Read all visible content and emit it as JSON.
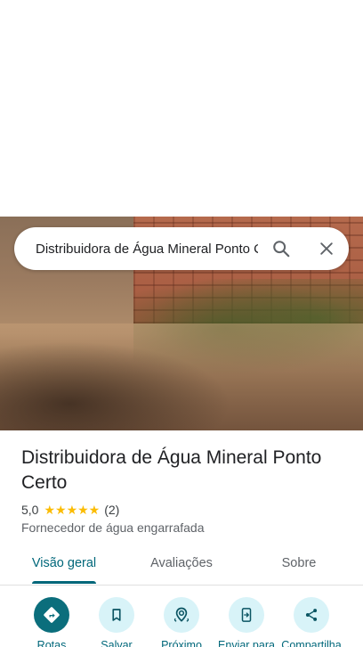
{
  "place_photo": {
    "description_icon": "photo"
  },
  "search": {
    "query": "Distribuidora de Água Mineral Ponto Certo"
  },
  "place": {
    "name": "Distribuidora de Água Mineral Ponto Certo",
    "rating": "5,0",
    "stars": "★★★★★",
    "review_count": "(2)",
    "rating_value": 5.0,
    "category": "Fornecedor de água engarrafada"
  },
  "tabs": [
    {
      "label": "Visão geral",
      "active": true
    },
    {
      "label": "Avaliações",
      "active": false
    },
    {
      "label": "Sobre",
      "active": false
    }
  ],
  "actions": [
    {
      "label": "Rotas",
      "icon": "directions-icon"
    },
    {
      "label": "Salvar",
      "icon": "bookmark-icon"
    },
    {
      "label": "Próximo",
      "icon": "nearby-icon"
    },
    {
      "label": "Enviar para",
      "icon": "send-to-phone-icon"
    },
    {
      "label": "Compartilha",
      "icon": "share-icon"
    }
  ],
  "colors": {
    "accent": "#00677a",
    "primary_action": "#0b6e7c",
    "action_bg": "#d8f3f8",
    "star": "#fbbc04"
  }
}
